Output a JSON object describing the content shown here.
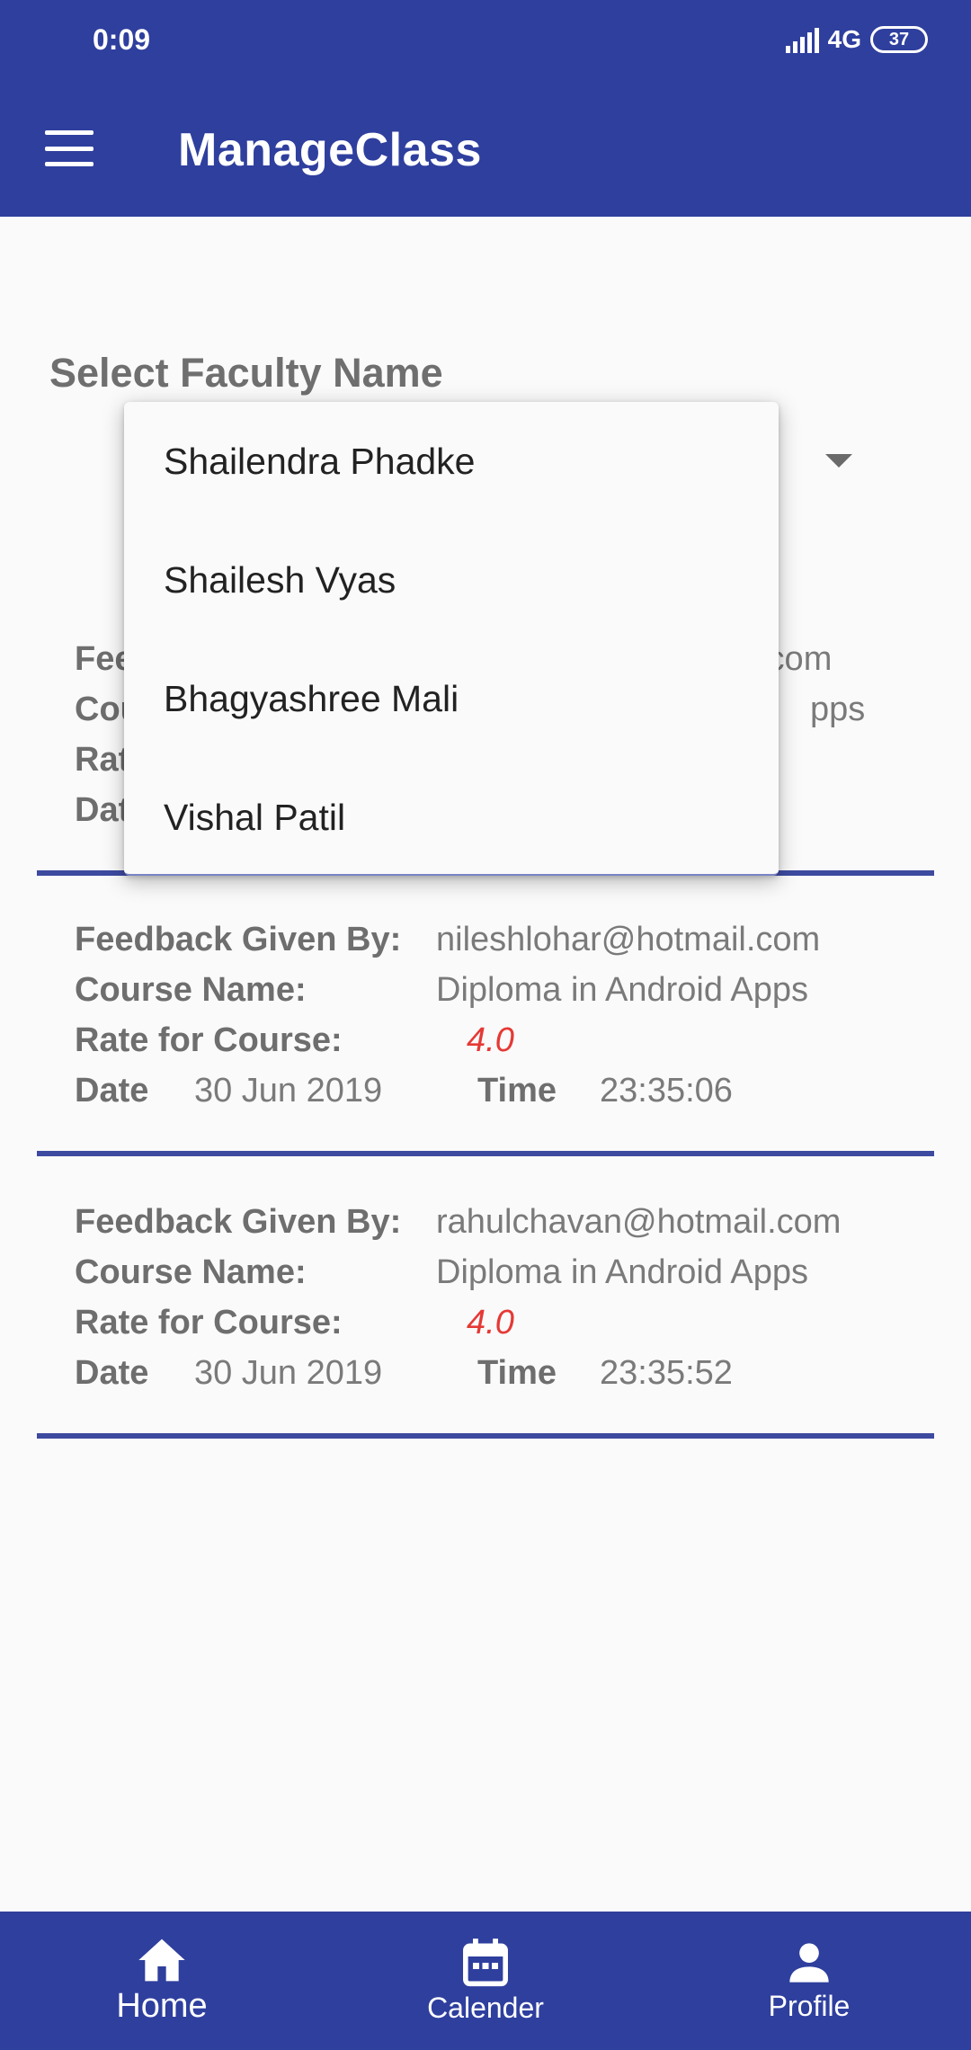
{
  "status_bar": {
    "time": "0:09",
    "network": "4G",
    "battery": "37"
  },
  "app_bar": {
    "title": "ManageClass",
    "menu_icon": "hamburger-menu-icon"
  },
  "faculty_selector": {
    "label": "Select Faculty Name",
    "options": [
      "Shailendra Phadke",
      "Shailesh Vyas",
      "Bhagyashree Mali",
      "Vishal Patil"
    ]
  },
  "feedback_labels": {
    "given_by": "Feedback Given By:",
    "course": "Course Name:",
    "rate": "Rate for Course:",
    "date": "Date",
    "time": "Time"
  },
  "feedback_list": [
    {
      "given_by": ".com",
      "course": "pps",
      "rate": "",
      "date": "",
      "time": ""
    },
    {
      "given_by": "nileshlohar@hotmail.com",
      "course": "Diploma in Android Apps",
      "rate": "4.0",
      "date": "30 Jun 2019",
      "time": "23:35:06"
    },
    {
      "given_by": "rahulchavan@hotmail.com",
      "course": "Diploma in Android Apps",
      "rate": "4.0",
      "date": "30 Jun 2019",
      "time": "23:35:52"
    }
  ],
  "bottom_nav": {
    "items": [
      {
        "label": "Home",
        "icon": "home-icon"
      },
      {
        "label": "Calender",
        "icon": "calendar-icon"
      },
      {
        "label": "Profile",
        "icon": "person-icon"
      }
    ]
  },
  "colors": {
    "primary": "#2f3f9e",
    "rating": "#e53935",
    "divider": "#3d4aa0"
  }
}
